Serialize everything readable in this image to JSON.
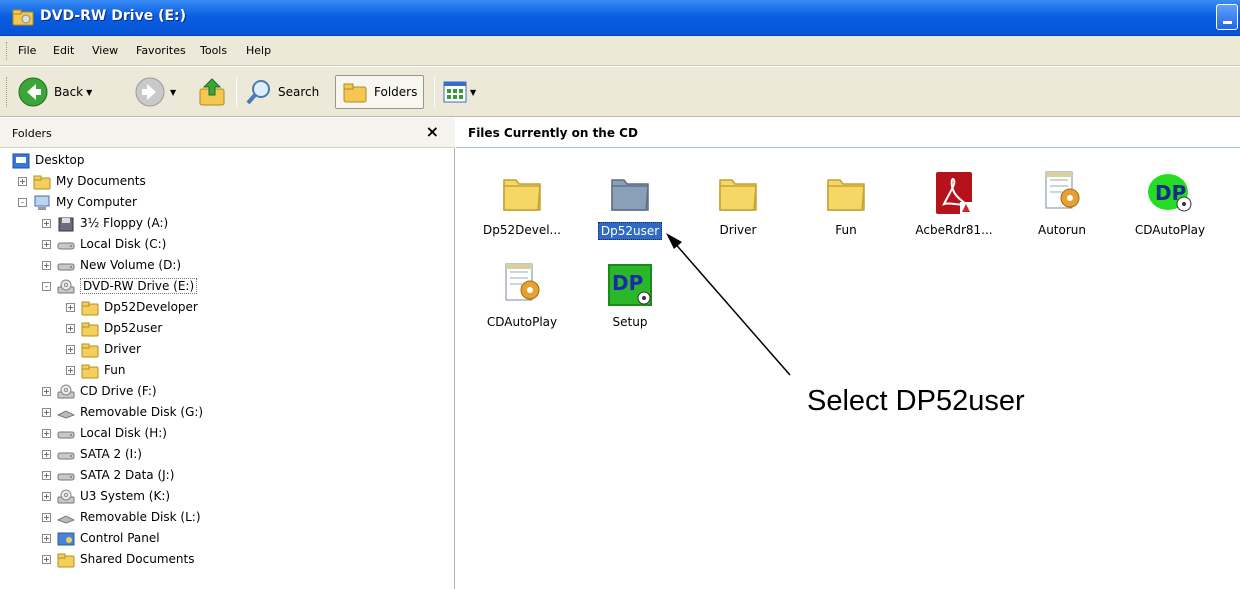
{
  "window": {
    "title": "DVD-RW Drive (E:)"
  },
  "menubar": {
    "items": [
      "File",
      "Edit",
      "View",
      "Favorites",
      "Tools",
      "Help"
    ]
  },
  "toolbar": {
    "back_label": "Back",
    "search_label": "Search",
    "folders_label": "Folders"
  },
  "left_pane": {
    "title": "Folders",
    "close_glyph": "×",
    "tree": [
      {
        "label": "Desktop",
        "icon": "desktop-icon",
        "level": 0,
        "expander": ""
      },
      {
        "label": "My Documents",
        "icon": "folder-icon",
        "level": 1,
        "expander": "+"
      },
      {
        "label": "My Computer",
        "icon": "computer-icon",
        "level": 1,
        "expander": "-"
      },
      {
        "label": "3½ Floppy (A:)",
        "icon": "floppy-icon",
        "level": 2,
        "expander": "+"
      },
      {
        "label": "Local Disk (C:)",
        "icon": "disk-icon",
        "level": 2,
        "expander": "+"
      },
      {
        "label": "New Volume (D:)",
        "icon": "disk-icon",
        "level": 2,
        "expander": "+"
      },
      {
        "label": "DVD-RW Drive (E:)",
        "icon": "cd-icon",
        "level": 2,
        "expander": "-",
        "selected": true
      },
      {
        "label": "Dp52Developer",
        "icon": "folder-icon",
        "level": 3,
        "expander": "+"
      },
      {
        "label": "Dp52user",
        "icon": "folder-icon",
        "level": 3,
        "expander": "+"
      },
      {
        "label": "Driver",
        "icon": "folder-icon",
        "level": 3,
        "expander": "+"
      },
      {
        "label": "Fun",
        "icon": "folder-icon",
        "level": 3,
        "expander": "+"
      },
      {
        "label": "CD Drive (F:)",
        "icon": "cd-icon",
        "level": 2,
        "expander": "+"
      },
      {
        "label": "Removable Disk (G:)",
        "icon": "removable-icon",
        "level": 2,
        "expander": "+"
      },
      {
        "label": "Local Disk (H:)",
        "icon": "disk-icon",
        "level": 2,
        "expander": "+"
      },
      {
        "label": "SATA 2 (I:)",
        "icon": "disk-icon",
        "level": 2,
        "expander": "+"
      },
      {
        "label": "SATA 2 Data (J:)",
        "icon": "disk-icon",
        "level": 2,
        "expander": "+"
      },
      {
        "label": "U3 System (K:)",
        "icon": "cd-icon",
        "level": 2,
        "expander": "+"
      },
      {
        "label": "Removable Disk (L:)",
        "icon": "removable-icon",
        "level": 2,
        "expander": "+"
      },
      {
        "label": "Control Panel",
        "icon": "control-panel-icon",
        "level": 2,
        "expander": "+"
      },
      {
        "label": "Shared Documents",
        "icon": "folder-icon",
        "level": 2,
        "expander": "+"
      }
    ]
  },
  "right_pane": {
    "title": "Files Currently on the CD",
    "items": [
      {
        "label": "Dp52Devel...",
        "icon": "folder-icon"
      },
      {
        "label": "Dp52user",
        "icon": "folder-icon",
        "selected": true
      },
      {
        "label": "Driver",
        "icon": "folder-icon"
      },
      {
        "label": "Fun",
        "icon": "folder-icon"
      },
      {
        "label": "AcbeRdr81...",
        "icon": "acrobat-icon"
      },
      {
        "label": "Autorun",
        "icon": "settings-file-icon"
      },
      {
        "label": "CDAutoPlay",
        "icon": "dp-app-icon"
      },
      {
        "label": "CDAutoPlay",
        "icon": "settings-file-icon"
      },
      {
        "label": "Setup",
        "icon": "dp-setup-icon"
      }
    ]
  },
  "annotation": {
    "text": "Select DP52user"
  }
}
